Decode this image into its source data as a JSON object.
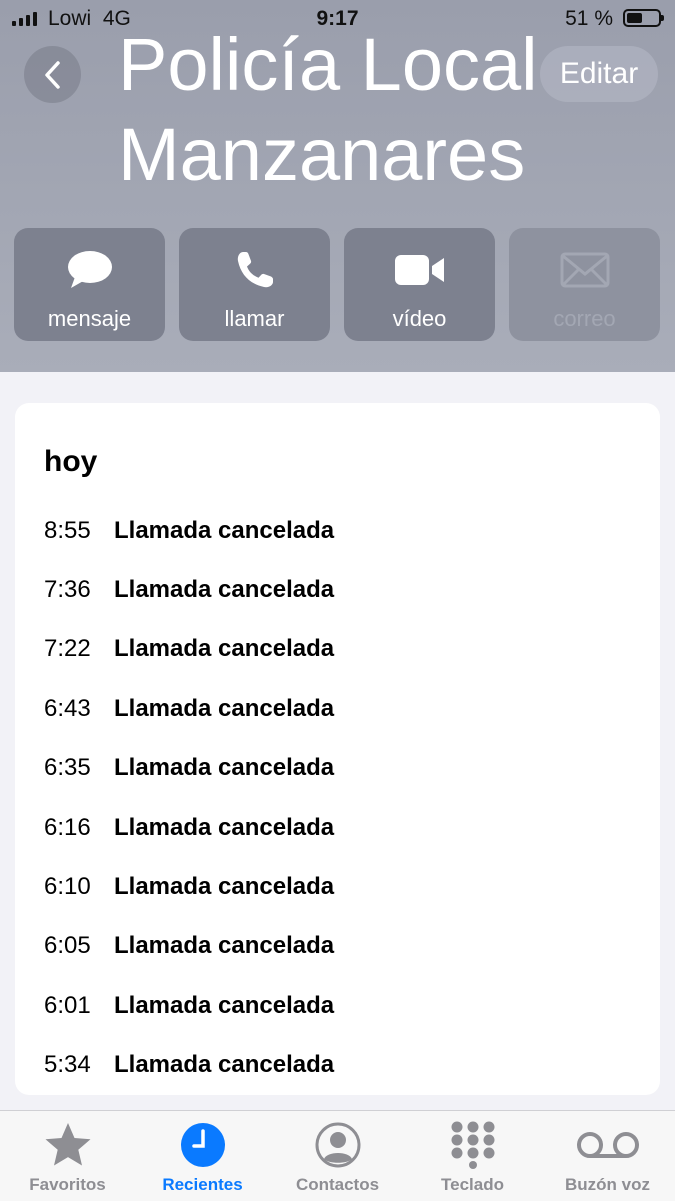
{
  "status_bar": {
    "carrier": "Lowi",
    "network": "4G",
    "time": "9:17",
    "battery_percent_label": "51 %",
    "battery_level": 0.51
  },
  "header": {
    "title": "Policía Local\nManzanares",
    "edit_label": "Editar",
    "back_icon": "chevron-left-icon"
  },
  "actions": [
    {
      "label": "mensaje",
      "icon": "message-bubble-icon",
      "enabled": true
    },
    {
      "label": "llamar",
      "icon": "phone-icon",
      "enabled": true
    },
    {
      "label": "vídeo",
      "icon": "video-camera-icon",
      "enabled": true
    },
    {
      "label": "correo",
      "icon": "envelope-icon",
      "enabled": false
    }
  ],
  "call_log": {
    "section": "hoy",
    "calls": [
      {
        "time": "8:55",
        "status": "Llamada cancelada"
      },
      {
        "time": "7:36",
        "status": "Llamada cancelada"
      },
      {
        "time": "7:22",
        "status": "Llamada cancelada"
      },
      {
        "time": "6:43",
        "status": "Llamada cancelada"
      },
      {
        "time": "6:35",
        "status": "Llamada cancelada"
      },
      {
        "time": "6:16",
        "status": "Llamada cancelada"
      },
      {
        "time": "6:10",
        "status": "Llamada cancelada"
      },
      {
        "time": "6:05",
        "status": "Llamada cancelada"
      },
      {
        "time": "6:01",
        "status": "Llamada cancelada"
      },
      {
        "time": "5:34",
        "status": "Llamada cancelada"
      }
    ]
  },
  "tab_bar": {
    "tabs": [
      {
        "label": "Favoritos",
        "icon": "star-icon",
        "active": false
      },
      {
        "label": "Recientes",
        "icon": "clock-icon",
        "active": true
      },
      {
        "label": "Contactos",
        "icon": "person-circle-icon",
        "active": false
      },
      {
        "label": "Teclado",
        "icon": "keypad-icon",
        "active": false
      },
      {
        "label": "Buzón voz",
        "icon": "voicemail-icon",
        "active": false
      }
    ]
  },
  "colors": {
    "accent": "#0a7aff",
    "header_bg": "#a3a7b4",
    "action_bg": "#7d818f"
  }
}
